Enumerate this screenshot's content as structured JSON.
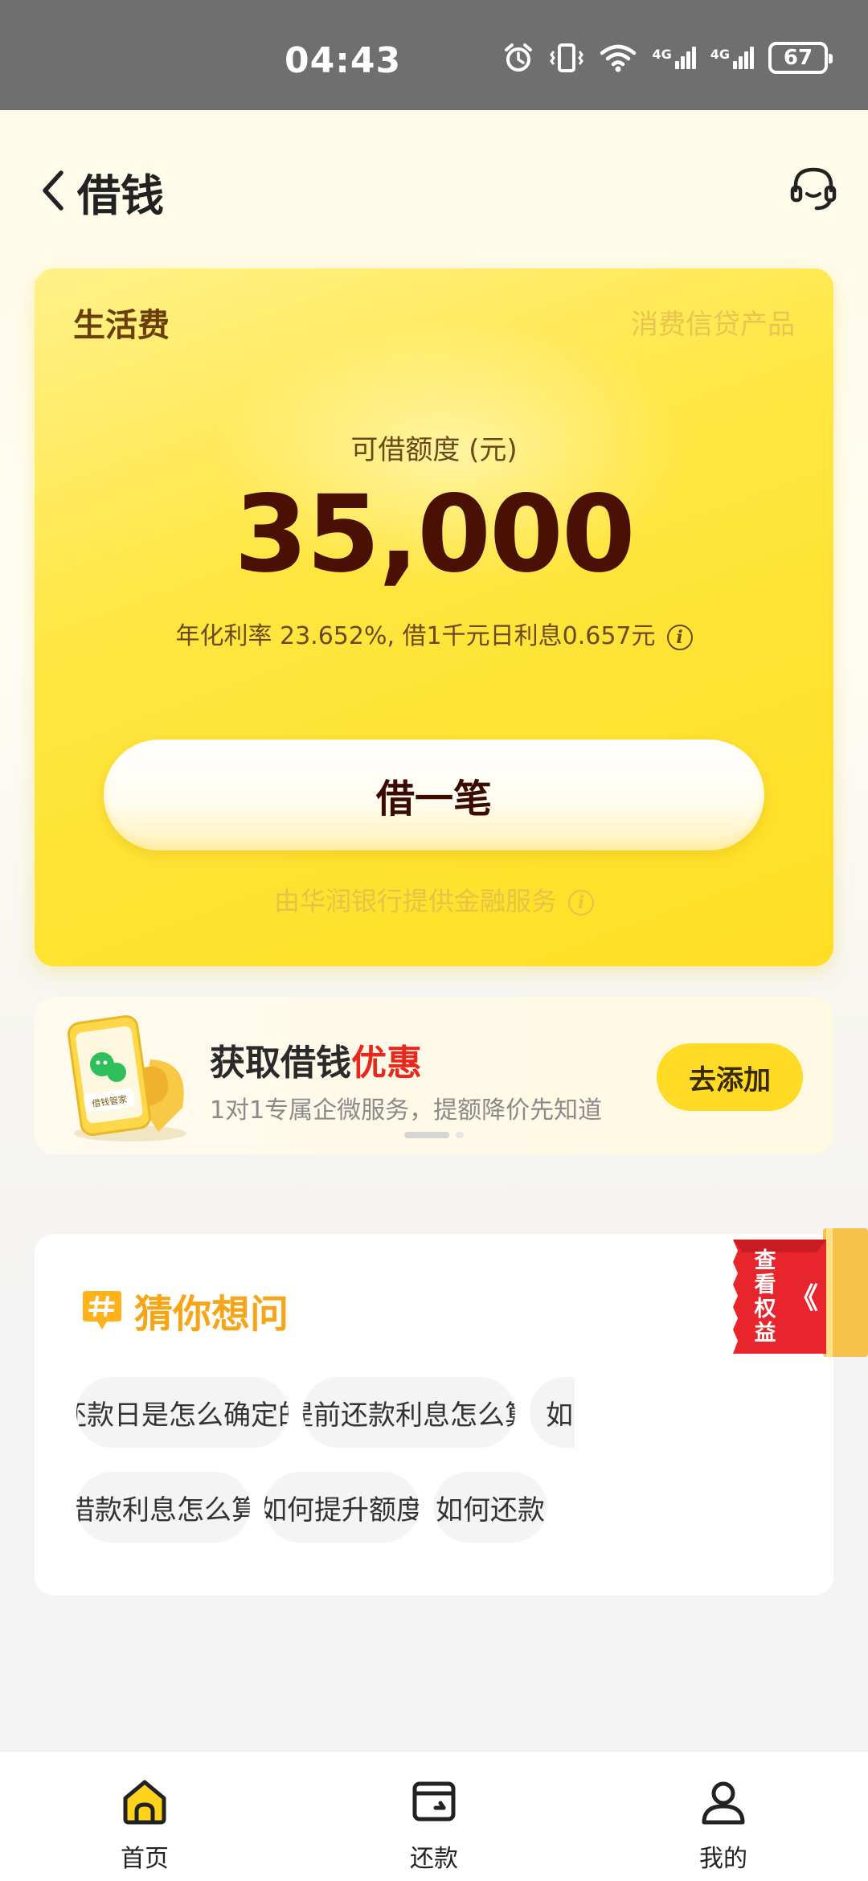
{
  "status_bar": {
    "time": "04:43",
    "battery": "67",
    "network_label": "4G"
  },
  "header": {
    "title": "借钱"
  },
  "credit_card": {
    "type": "生活费",
    "product": "消费信贷产品",
    "limit_label": "可借额度 (元)",
    "limit_amount": "35,000",
    "rate_text": "年化利率 23.652%, 借1千元日利息0.657元",
    "borrow_button": "借一笔",
    "provider": "由华润银行提供金融服务"
  },
  "promo": {
    "title": "获取借钱",
    "title_highlight": "优惠",
    "subtitle": "1对1专属企微服务，提额降价先知道",
    "button": "去添加",
    "illustration_label": "借钱管家"
  },
  "faq": {
    "title": "猜你想问",
    "chips": [
      "还款日是怎么确定的",
      "提前还款利息怎么算",
      "如",
      "借款利息怎么算",
      "如何提升额度",
      "如何还款"
    ]
  },
  "benefit": {
    "label": "查看权益",
    "arrow": "《"
  },
  "bottom_nav": {
    "items": [
      {
        "label": "首页",
        "icon": "home-icon",
        "active": true
      },
      {
        "label": "还款",
        "icon": "wallet-icon",
        "active": false
      },
      {
        "label": "我的",
        "icon": "profile-icon",
        "active": false
      }
    ]
  },
  "colors": {
    "brand_yellow": "#ffe030",
    "amount": "#4a1004",
    "highlight_red": "#e8281d",
    "faq_title": "#f5a516",
    "benefit_red": "#e8252c"
  }
}
